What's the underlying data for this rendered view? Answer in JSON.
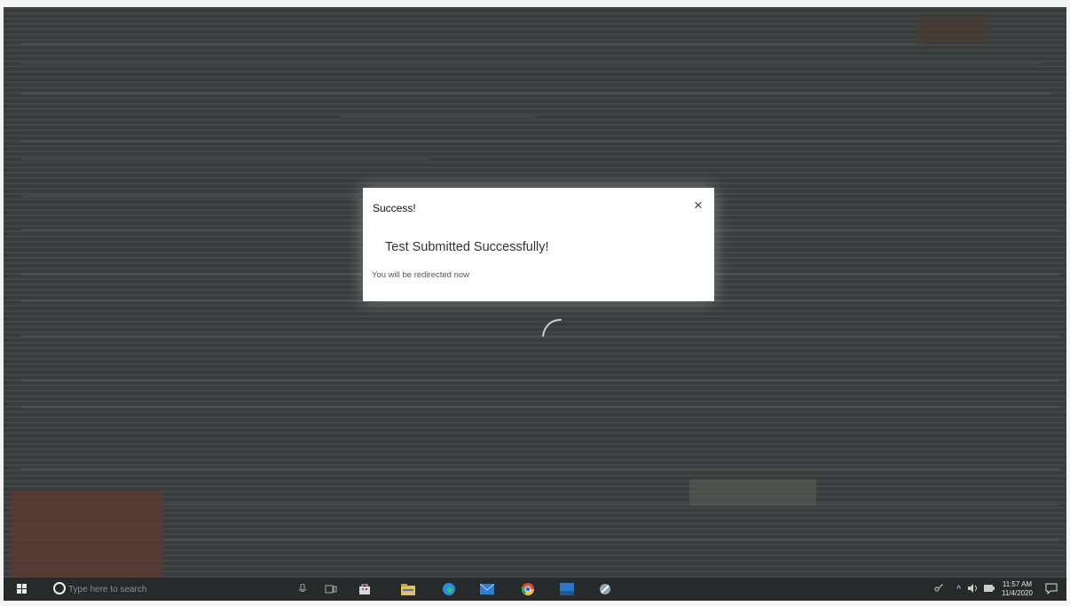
{
  "modal": {
    "title": "Success!",
    "close_symbol": "×",
    "message": "Test Submitted Successfully!",
    "subtext": "You will be redirected now"
  },
  "taskbar": {
    "search_placeholder": "Type here to search",
    "icons": [
      "windows-start-icon",
      "cortana-icon",
      "microphone-icon",
      "task-view-icon",
      "store-icon",
      "file-explorer-icon",
      "edge-icon",
      "mail-icon",
      "chrome-icon",
      "app-icon",
      "snip-icon"
    ],
    "time": "11:57 AM",
    "date": "11/4/2020"
  },
  "colors": {
    "screen_bg": "#3b3f40",
    "taskbar_bg": "#262a2b",
    "modal_bg": "#ffffff"
  }
}
